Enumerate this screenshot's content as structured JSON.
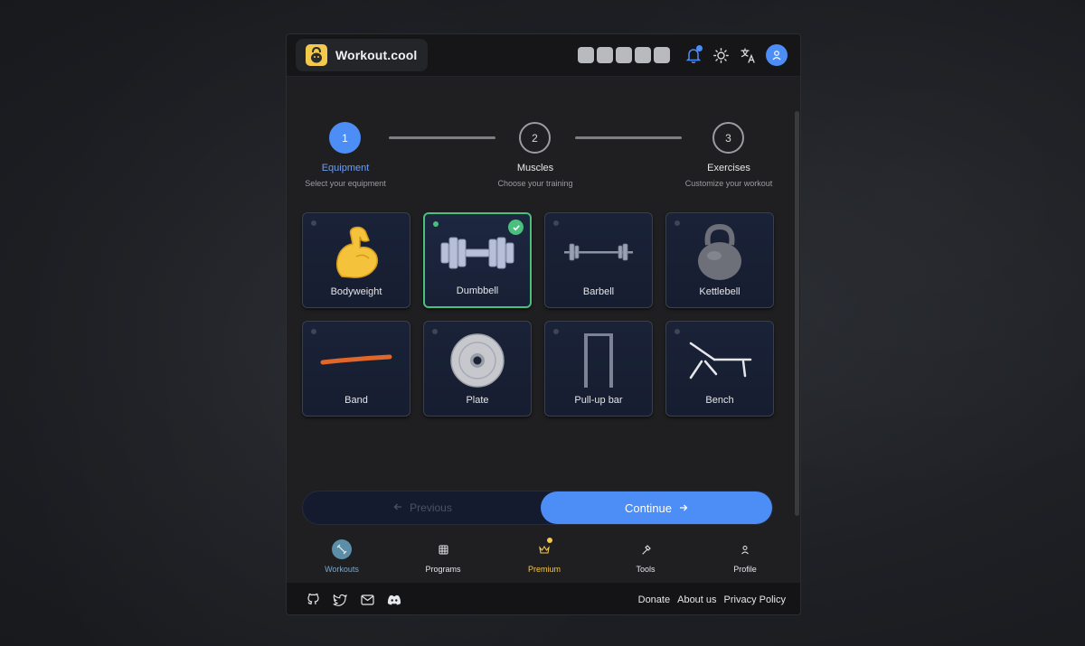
{
  "app": {
    "name": "Workout.cool"
  },
  "stepper": {
    "steps": [
      {
        "number": "1",
        "title": "Equipment",
        "subtitle": "Select your equipment"
      },
      {
        "number": "2",
        "title": "Muscles",
        "subtitle": "Choose your training"
      },
      {
        "number": "3",
        "title": "Exercises",
        "subtitle": "Customize your workout"
      }
    ],
    "active_index": 0
  },
  "equipment": [
    {
      "label": "Bodyweight",
      "icon": "flexed-biceps-icon",
      "selected": false
    },
    {
      "label": "Dumbbell",
      "icon": "dumbbell-icon",
      "selected": true
    },
    {
      "label": "Barbell",
      "icon": "barbell-icon",
      "selected": false
    },
    {
      "label": "Kettlebell",
      "icon": "kettlebell-icon",
      "selected": false
    },
    {
      "label": "Band",
      "icon": "resistance-band-icon",
      "selected": false
    },
    {
      "label": "Plate",
      "icon": "weight-plate-icon",
      "selected": false
    },
    {
      "label": "Pull-up bar",
      "icon": "pull-up-bar-icon",
      "selected": false
    },
    {
      "label": "Bench",
      "icon": "bench-icon",
      "selected": false
    }
  ],
  "actions": {
    "previous": "Previous",
    "continue": "Continue"
  },
  "tabs": [
    {
      "label": "Workouts",
      "icon": "workouts-icon",
      "active": true
    },
    {
      "label": "Programs",
      "icon": "grid-icon",
      "active": false
    },
    {
      "label": "Premium",
      "icon": "crown-icon",
      "active": false
    },
    {
      "label": "Tools",
      "icon": "hammer-icon",
      "active": false
    },
    {
      "label": "Profile",
      "icon": "user-icon",
      "active": false
    }
  ],
  "footer": {
    "social": [
      "github-icon",
      "twitter-icon",
      "mail-icon",
      "discord-icon"
    ],
    "links": [
      "Donate",
      "About us",
      "Privacy Policy"
    ]
  },
  "colors": {
    "accent": "#4c8df6",
    "selected": "#4bbf7e",
    "premium": "#f2c94c"
  }
}
